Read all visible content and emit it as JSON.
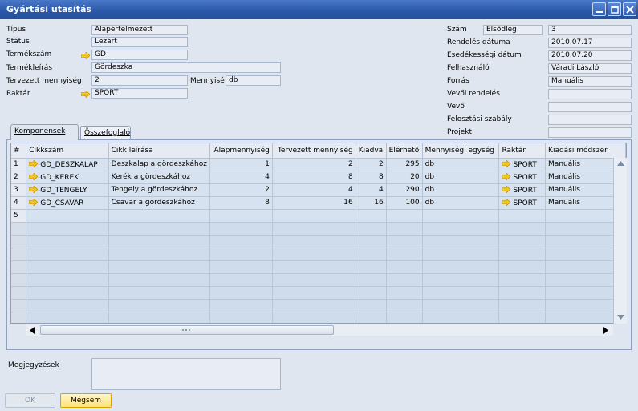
{
  "window": {
    "title": "Gyártási utasítás"
  },
  "header_left": {
    "tipus_label": "Típus",
    "tipus_value": "Alapértelmezett",
    "status_label": "Státus",
    "status_value": "Lezárt",
    "termekszam_label": "Termékszám",
    "termekszam_value": "GD",
    "termekleiras_label": "Termékleírás",
    "termekleiras_value": "Gördeszka",
    "tervezett_label": "Tervezett mennyiség",
    "tervezett_value": "2",
    "mennyisegi_label": "Mennyisé",
    "mennyisegi_value": "db",
    "raktar_label": "Raktár",
    "raktar_value": "SPORT"
  },
  "header_right": {
    "szam_label": "Szám",
    "szam_series": "Elsődleg",
    "szam_value": "3",
    "rendeles_label": "Rendelés dátuma",
    "rendeles_value": "2010.07.17",
    "esedekessegi_label": "Esedékességi dátum",
    "esedekessegi_value": "2010.07.20",
    "felhasznalo_label": "Felhasználó",
    "felhasznalo_value": "Váradi László",
    "forras_label": "Forrás",
    "forras_value": "Manuális",
    "vevoi_rendeles_label": "Vevői rendelés",
    "vevoi_rendeles_value": "",
    "vevo_label": "Vevő",
    "vevo_value": "",
    "felosztasi_label": "Felosztási szabály",
    "felosztasi_value": "",
    "projekt_label": "Projekt",
    "projekt_value": ""
  },
  "tabs": [
    {
      "label": "Komponensek",
      "active": true
    },
    {
      "label": "Összefoglaló",
      "active": false
    }
  ],
  "table": {
    "columns": [
      "#",
      "Cikkszám",
      "Cikk leírása",
      "Alapmennyiség",
      "Tervezett mennyiség",
      "Kiadva",
      "Elérhető",
      "Mennyiségi egység",
      "Raktár",
      "Kiadási módszer"
    ],
    "rows": [
      {
        "num": "1",
        "cikkszam": "GD_DESZKALAP",
        "leiras": "Deszkalap a gördeszkához",
        "alap": "1",
        "tervezett": "2",
        "kiadva": "2",
        "elerheto": "295",
        "egyseg": "db",
        "raktar": "SPORT",
        "modszer": "Manuális"
      },
      {
        "num": "2",
        "cikkszam": "GD_KEREK",
        "leiras": "Kerék a gördeszkához",
        "alap": "4",
        "tervezett": "8",
        "kiadva": "8",
        "elerheto": "20",
        "egyseg": "db",
        "raktar": "SPORT",
        "modszer": "Manuális"
      },
      {
        "num": "3",
        "cikkszam": "GD_TENGELY",
        "leiras": "Tengely a gördeszkához",
        "alap": "2",
        "tervezett": "4",
        "kiadva": "4",
        "elerheto": "290",
        "egyseg": "db",
        "raktar": "SPORT",
        "modszer": "Manuális"
      },
      {
        "num": "4",
        "cikkszam": "GD_CSAVAR",
        "leiras": "Csavar a gördeszkához",
        "alap": "8",
        "tervezett": "16",
        "kiadva": "16",
        "elerheto": "100",
        "egyseg": "db",
        "raktar": "SPORT",
        "modszer": "Manuális"
      },
      {
        "num": "5",
        "cikkszam": "",
        "leiras": "",
        "alap": "",
        "tervezett": "",
        "kiadva": "",
        "elerheto": "",
        "egyseg": "",
        "raktar": "",
        "modszer": ""
      }
    ]
  },
  "footer": {
    "megjegyzesek_label": "Megjegyzések",
    "megjegyzesek_value": "",
    "ok_label": "OK",
    "megsem_label": "Mégsem"
  },
  "colors": {
    "link_arrow": "#f5c518",
    "field_bg": "#e7ecf5",
    "grid_row": "#d7e2f0",
    "button_border": "#d9a400"
  },
  "icons": {
    "link": "link-arrow-icon",
    "minimize": "minimize-icon",
    "maximize": "maximize-icon",
    "close": "close-icon"
  }
}
